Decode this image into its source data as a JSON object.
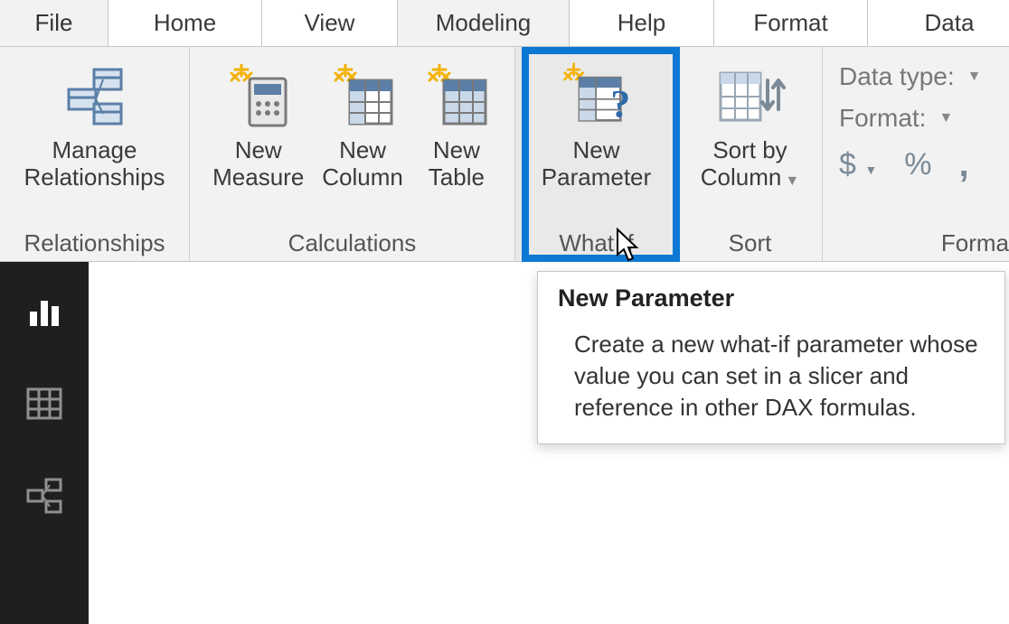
{
  "menubar": {
    "file": "File",
    "home": "Home",
    "view": "View",
    "modeling": "Modeling",
    "help": "Help",
    "format": "Format",
    "data": "Data",
    "active": "modeling"
  },
  "ribbon": {
    "relationships": {
      "group_label": "Relationships",
      "manage": {
        "line1": "Manage",
        "line2": "Relationships"
      }
    },
    "calculations": {
      "group_label": "Calculations",
      "measure": {
        "line1": "New",
        "line2": "Measure"
      },
      "column": {
        "line1": "New",
        "line2": "Column"
      },
      "table": {
        "line1": "New",
        "line2": "Table"
      }
    },
    "whatif": {
      "group_label": "What If",
      "parameter": {
        "line1": "New",
        "line2": "Parameter"
      }
    },
    "sort": {
      "group_label": "Sort",
      "sortby": {
        "line1": "Sort by",
        "line2": "Column"
      }
    },
    "formatting": {
      "group_label": "Forma",
      "data_type_label": "Data type:",
      "format_label": "Format:",
      "currency_symbol": "$",
      "percent_symbol": "%",
      "comma_symbol": ","
    }
  },
  "tooltip": {
    "title": "New Parameter",
    "body": "Create a new what-if parameter whose value you can set in a slicer and reference in other DAX formulas."
  },
  "leftnav": {
    "items": [
      "report-view",
      "data-view",
      "model-view"
    ]
  },
  "colors": {
    "highlight": "#0c78d4",
    "ribbon_bg": "#f2f2f2",
    "icon_blue": "#5b7fa6",
    "icon_light": "#d6e2ef",
    "sparkle": "#f5b100"
  }
}
